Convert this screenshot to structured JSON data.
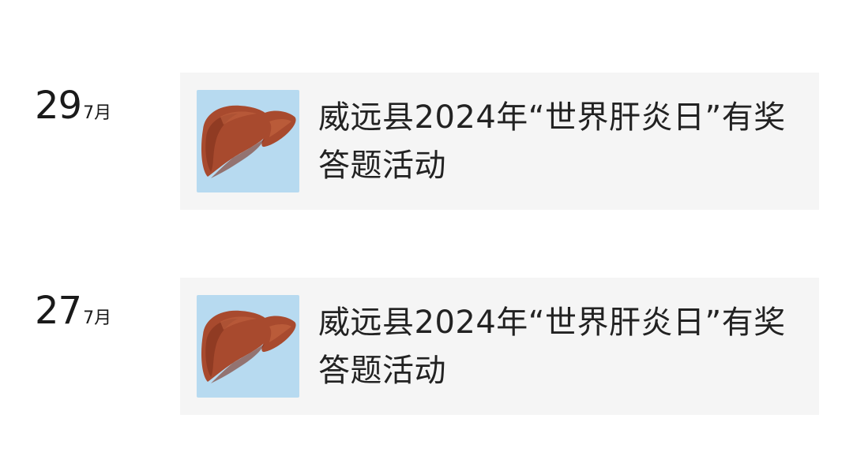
{
  "feed": {
    "entries": [
      {
        "day": "29",
        "month": "7月",
        "title": "威远县2024年“世界肝炎日”有奖答题活动",
        "thumbnail_icon": "liver-icon"
      },
      {
        "day": "27",
        "month": "7月",
        "title": "威远县2024年“世界肝炎日”有奖答题活动",
        "thumbnail_icon": "liver-icon"
      }
    ]
  },
  "colors": {
    "card_background": "#f5f5f5",
    "thumbnail_background": "#b7daf0",
    "liver_main": "#a84a2e",
    "liver_dark": "#7c2f1c",
    "liver_highlight": "#c2623f"
  }
}
